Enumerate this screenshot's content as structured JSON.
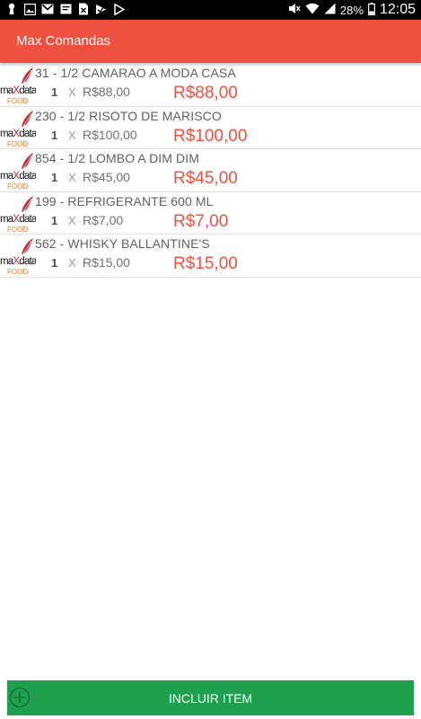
{
  "status_bar": {
    "battery_percent": "28%",
    "time": "12:05",
    "left_icons": [
      "keyhole-icon",
      "image-icon",
      "gmail-icon",
      "message-icon",
      "file-x-icon",
      "checkmark-icon",
      "play-store-icon"
    ],
    "right_icons": [
      "mute-icon",
      "wifi-icon",
      "signal-icon",
      "battery-icon"
    ]
  },
  "app_bar": {
    "title": "Max Comandas"
  },
  "items": [
    {
      "name": "31 - 1/2 CAMARAO A MODA CASA",
      "qty": "1",
      "x": "X",
      "unit_price": "R$88,00",
      "total": "R$88,00"
    },
    {
      "name": "230 - 1/2 RISOTO DE MARISCO",
      "qty": "1",
      "x": "X",
      "unit_price": "R$100,00",
      "total": "R$100,00"
    },
    {
      "name": "854 - 1/2 LOMBO A DIM DIM",
      "qty": "1",
      "x": "X",
      "unit_price": "R$45,00",
      "total": "R$45,00"
    },
    {
      "name": "199 - REFRIGERANTE 600 ML",
      "qty": "1",
      "x": "X",
      "unit_price": "R$7,00",
      "total": "R$7,00"
    },
    {
      "name": "562 - WHISKY BALLANTINE'S",
      "qty": "1",
      "x": "X",
      "unit_price": "R$15,00",
      "total": "R$15,00"
    }
  ],
  "logo": {
    "text_main": "maXdata",
    "text_sub": "FOOD"
  },
  "add_button": {
    "label": "INCLUIR ITEM"
  },
  "colors": {
    "accent": "#ef5140",
    "button_green": "#1ea04f",
    "status_bar": "#000000"
  }
}
